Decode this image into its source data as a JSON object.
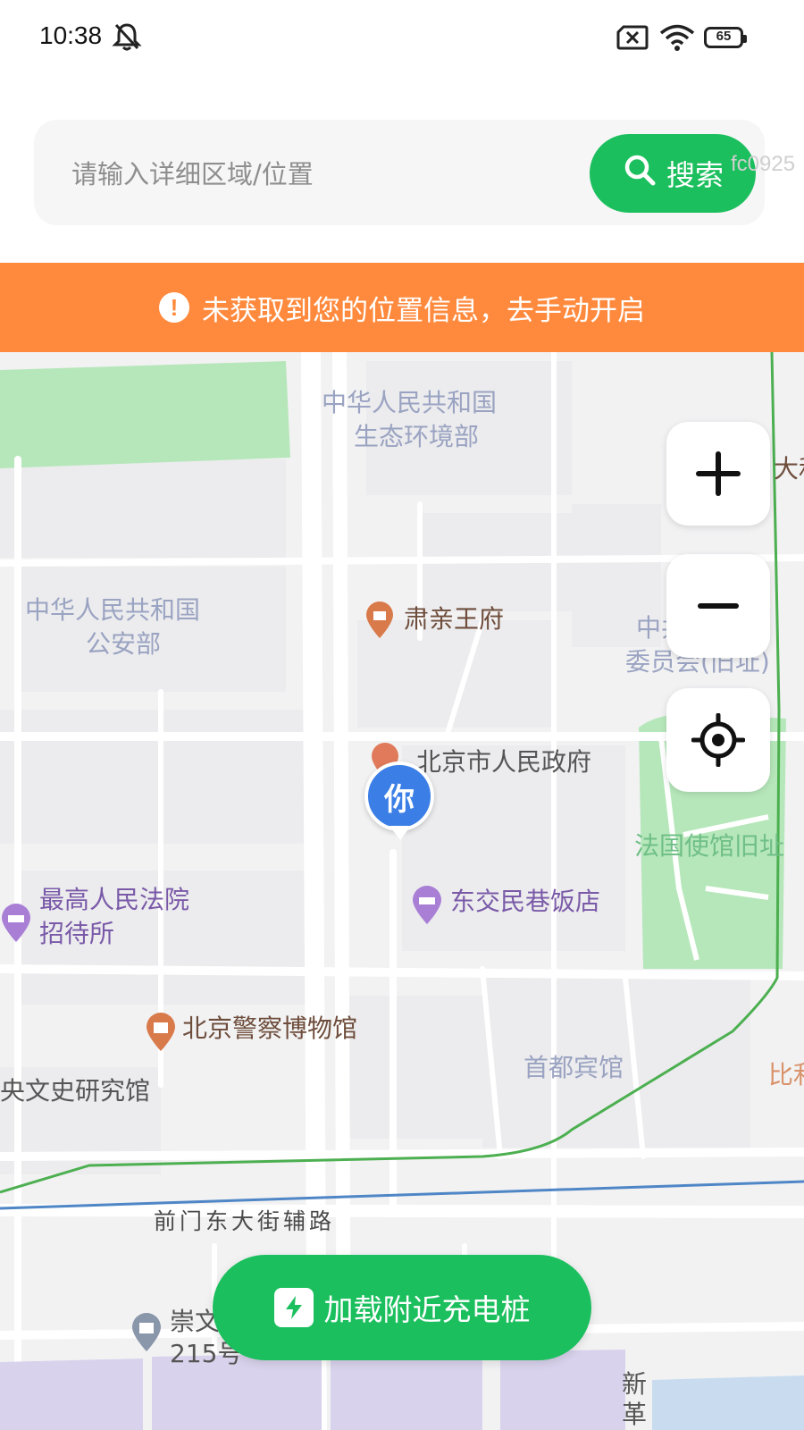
{
  "status_bar": {
    "time": "10:38",
    "battery": "65"
  },
  "search": {
    "placeholder": "请输入详细区域/位置",
    "button_label": "搜索",
    "watermark": "fc0925"
  },
  "location_alert": {
    "text": "未获取到您的位置信息，去手动开启",
    "icon": "exclamation-icon"
  },
  "map": {
    "labels": {
      "ministry_eco_1": "中华人民共和国",
      "ministry_eco_2": "生态环境部",
      "ministry_ps_1": "中华人民共和国",
      "ministry_ps_2": "公安部",
      "suqin": "肃亲王府",
      "committee_1": "中共",
      "committee_2": "委员会(旧址)",
      "beijing_gov": "北京市人民政府",
      "french_embassy": "法国使馆旧址",
      "supreme_court_1": "最高人民法院",
      "supreme_court_2": "招待所",
      "dongjiao_hotel": "东交民巷饭店",
      "police_museum": "北京警察博物馆",
      "shoudu_hotel": "首都宾馆",
      "wenshi": "央文史研究馆",
      "road": "前门东大街辅路",
      "chongwen_1": "崇文",
      "chongwen_2": "215号",
      "xin_1": "新",
      "xin_2": "革",
      "edge_top": "大和",
      "edge_bottom": "比利"
    },
    "you_marker": "你",
    "controls": {
      "zoom_in": "+",
      "zoom_out": "−",
      "locate": "locate-icon"
    }
  },
  "charge_button": {
    "label": "加载附近充电桩",
    "icon": "lightning-icon"
  },
  "colors": {
    "accent": "#1cbf5e",
    "alert": "#ff8a3d",
    "you_marker": "#3a7ee6"
  }
}
